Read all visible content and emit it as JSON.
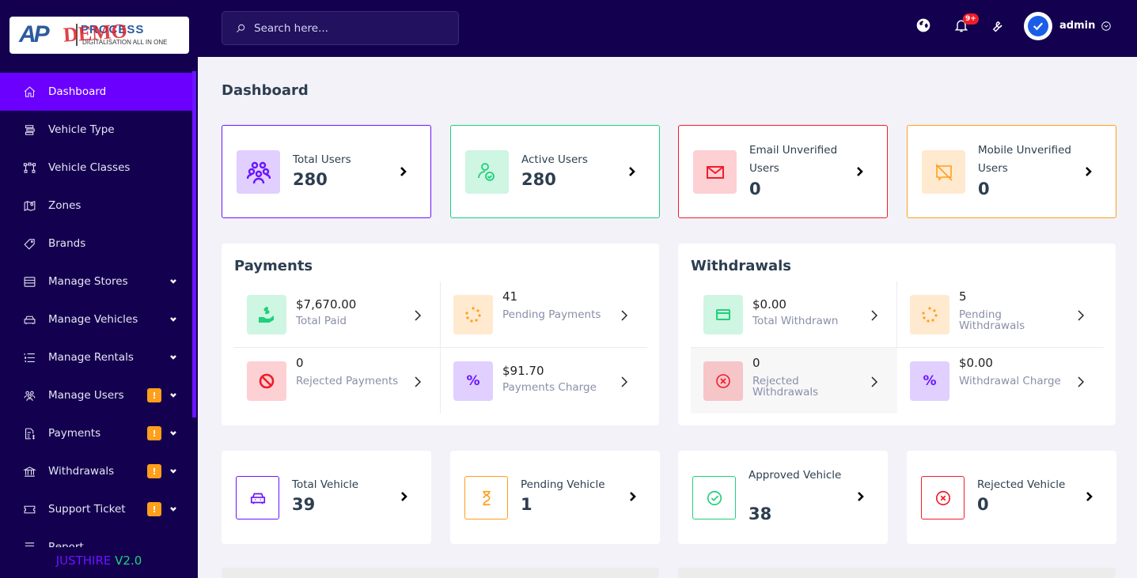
{
  "brand": {
    "logo_mark": "AP",
    "logo_name": "PROCESS",
    "logo_tagline": "DIGITALISATION ALL IN ONE",
    "watermark": "DEMO",
    "footer_name": "JUSTHIRE",
    "footer_version": "V2.0"
  },
  "sidebar": {
    "items": [
      {
        "label": "Dashboard",
        "icon": "home-icon",
        "active": true
      },
      {
        "label": "Vehicle Type",
        "icon": "list-stack-icon"
      },
      {
        "label": "Vehicle Classes",
        "icon": "hierarchy-icon"
      },
      {
        "label": "Zones",
        "icon": "map-pin-icon"
      },
      {
        "label": "Brands",
        "icon": "tag-icon"
      },
      {
        "label": "Manage Stores",
        "icon": "store-icon",
        "expandable": true
      },
      {
        "label": "Manage Vehicles",
        "icon": "car-icon",
        "expandable": true
      },
      {
        "label": "Manage Rentals",
        "icon": "numbered-list-icon",
        "expandable": true
      },
      {
        "label": "Manage Users",
        "icon": "users-icon",
        "badge": "!",
        "expandable": true
      },
      {
        "label": "Payments",
        "icon": "invoice-dollar-icon",
        "badge": "!",
        "expandable": true
      },
      {
        "label": "Withdrawals",
        "icon": "bank-icon",
        "badge": "!",
        "expandable": true
      },
      {
        "label": "Support Ticket",
        "icon": "ticket-icon",
        "badge": "!",
        "expandable": true
      },
      {
        "label": "Report",
        "icon": "report-icon"
      }
    ]
  },
  "topbar": {
    "search_placeholder": "Search here...",
    "notification_count": "9+",
    "username": "admin"
  },
  "page": {
    "title": "Dashboard"
  },
  "user_stats": [
    {
      "label": "Total Users",
      "value": "280",
      "color": "#6b14ff",
      "bg": "#e0cfff"
    },
    {
      "label": "Active Users",
      "value": "280",
      "color": "#1ed17a",
      "bg": "#cff5e3"
    },
    {
      "label": "Email Unverified Users",
      "value": "0",
      "color": "#ef1d2a",
      "bg": "#fdd0d3"
    },
    {
      "label": "Mobile Unverified Users",
      "value": "0",
      "color": "#ff9f1c",
      "bg": "#ffe9cf"
    }
  ],
  "payments": {
    "title": "Payments",
    "cells": [
      {
        "value": "$7,670.00",
        "label": "Total Paid"
      },
      {
        "value": "41",
        "label": "Pending Payments"
      },
      {
        "value": "0",
        "label": "Rejected Payments"
      },
      {
        "value": "$91.70",
        "label": "Payments Charge"
      }
    ]
  },
  "withdrawals": {
    "title": "Withdrawals",
    "cells": [
      {
        "value": "$0.00",
        "label": "Total Withdrawn"
      },
      {
        "value": "5",
        "label": "Pending Withdrawals"
      },
      {
        "value": "0",
        "label": "Rejected Withdrawals"
      },
      {
        "value": "$0.00",
        "label": "Withdrawal Charge"
      }
    ]
  },
  "vehicle_stats": [
    {
      "label": "Total Vehicle",
      "value": "39",
      "color": "#6b14ff"
    },
    {
      "label": "Pending Vehicle",
      "value": "1",
      "color": "#ff9f1c"
    },
    {
      "label": "Approved Vehicle",
      "value": "38",
      "color": "#1ed17a"
    },
    {
      "label": "Rejected Vehicle",
      "value": "0",
      "color": "#ef1d2a"
    }
  ]
}
